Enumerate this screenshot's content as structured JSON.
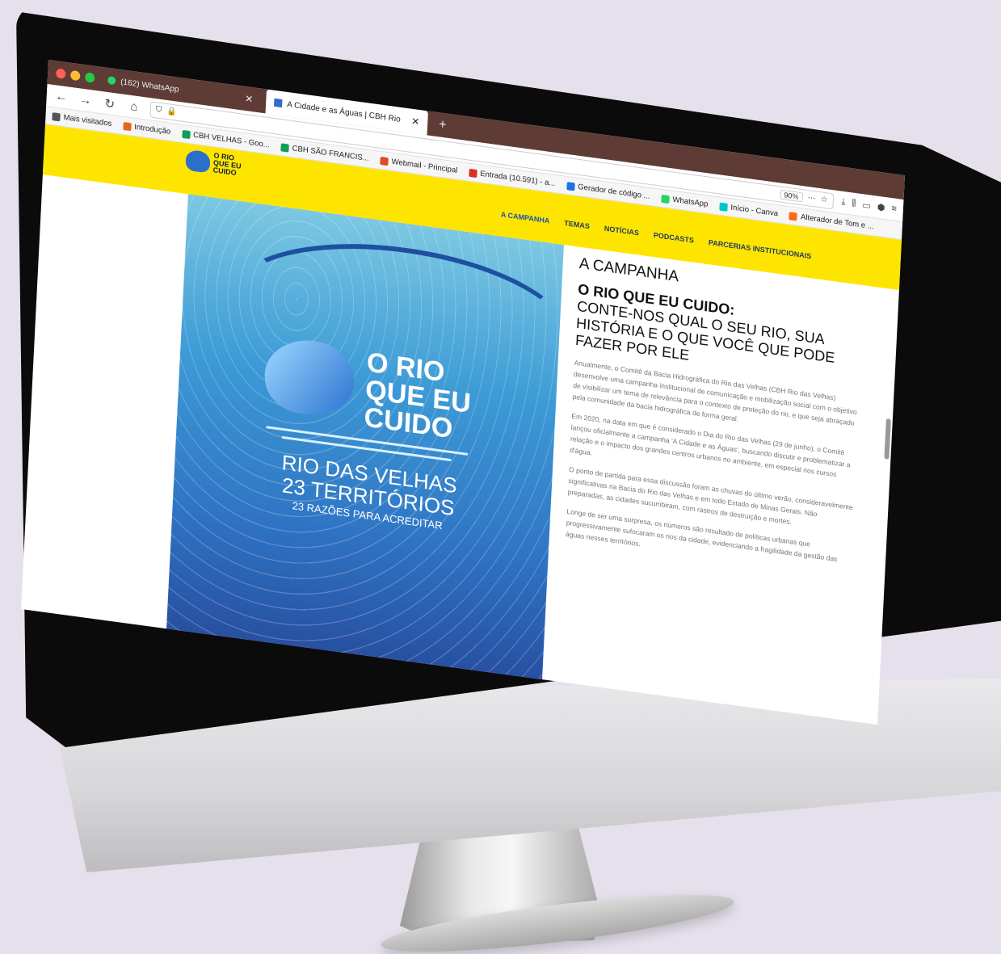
{
  "browser": {
    "tabs": [
      {
        "label": "(162) WhatsApp",
        "icon": "whatsapp-icon"
      },
      {
        "label": "A Cidade e as Águas | CBH Rio",
        "icon": "cbh-icon"
      }
    ],
    "zoom": "90%",
    "bookmarks": [
      {
        "label": "Mais visitados",
        "color": "#555555"
      },
      {
        "label": "Introdução",
        "color": "#e8661b"
      },
      {
        "label": "CBH VELHAS - Goo...",
        "color": "#0f9d58"
      },
      {
        "label": "CBH SÃO FRANCIS...",
        "color": "#0f9d58"
      },
      {
        "label": "Webmail - Principal",
        "color": "#e14b1f"
      },
      {
        "label": "Entrada (10.591) - a...",
        "color": "#d93025"
      },
      {
        "label": "Gerador de código ...",
        "color": "#1a73e8"
      },
      {
        "label": "WhatsApp",
        "color": "#25d366"
      },
      {
        "label": "Início - Canva",
        "color": "#00c4cc"
      },
      {
        "label": "Alterador de Tom e ...",
        "color": "#ff6a13"
      }
    ]
  },
  "site": {
    "logo_text": "O RIO QUE EU CUIDO",
    "nav": [
      "A CAMPANHA",
      "TEMAS",
      "NOTÍCIAS",
      "PODCASTS",
      "PARCERIAS INSTITUCIONAIS"
    ],
    "accent": "#fee500"
  },
  "poster": {
    "brand": [
      "O RIO",
      "QUE EU",
      "CUIDO"
    ],
    "title_line1": "RIO DAS VELHAS",
    "title_line2": "23 TERRITÓRIOS",
    "subtitle": "23 RAZÕES PARA ACREDITAR"
  },
  "article": {
    "kicker": "A CAMPANHA",
    "headline": "O RIO QUE EU CUIDO:",
    "subhead": "CONTE-NOS QUAL O SEU RIO, SUA HISTÓRIA E O QUE VOCÊ QUE PODE FAZER POR ELE",
    "paragraphs": [
      "Anualmente, o Comitê da Bacia Hidrográfica do Rio das Velhas (CBH Rio das Velhas) desenvolve uma campanha institucional de comunicação e mobilização social com o objetivo de visibilizar um tema de relevância para o contexto de proteção do rio, e que seja abraçado pela comunidade da bacia hidrográfica de forma geral.",
      "Em 2020, na data em que é considerado o Dia do Rio das Velhas (29 de junho), o Comitê lançou oficialmente a campanha 'A Cidade e as Águas', buscando discutir e problematizar a relação e o impacto dos grandes centros urbanos no ambiente, em especial nos cursos d'água.",
      "O ponto de partida para essa discussão foram as chuvas do último verão, consideravelmente significativas na Bacia do Rio das Velhas e em todo Estado de Minas Gerais. Não preparadas, as cidades sucumbiram, com rastros de destruição e mortes.",
      "Longe de ser uma surpresa, os números são resultado de políticas urbanas que progressivamente sufocaram os rios da cidade, evidenciando a fragilidade da gestão das águas nesses territórios."
    ]
  }
}
